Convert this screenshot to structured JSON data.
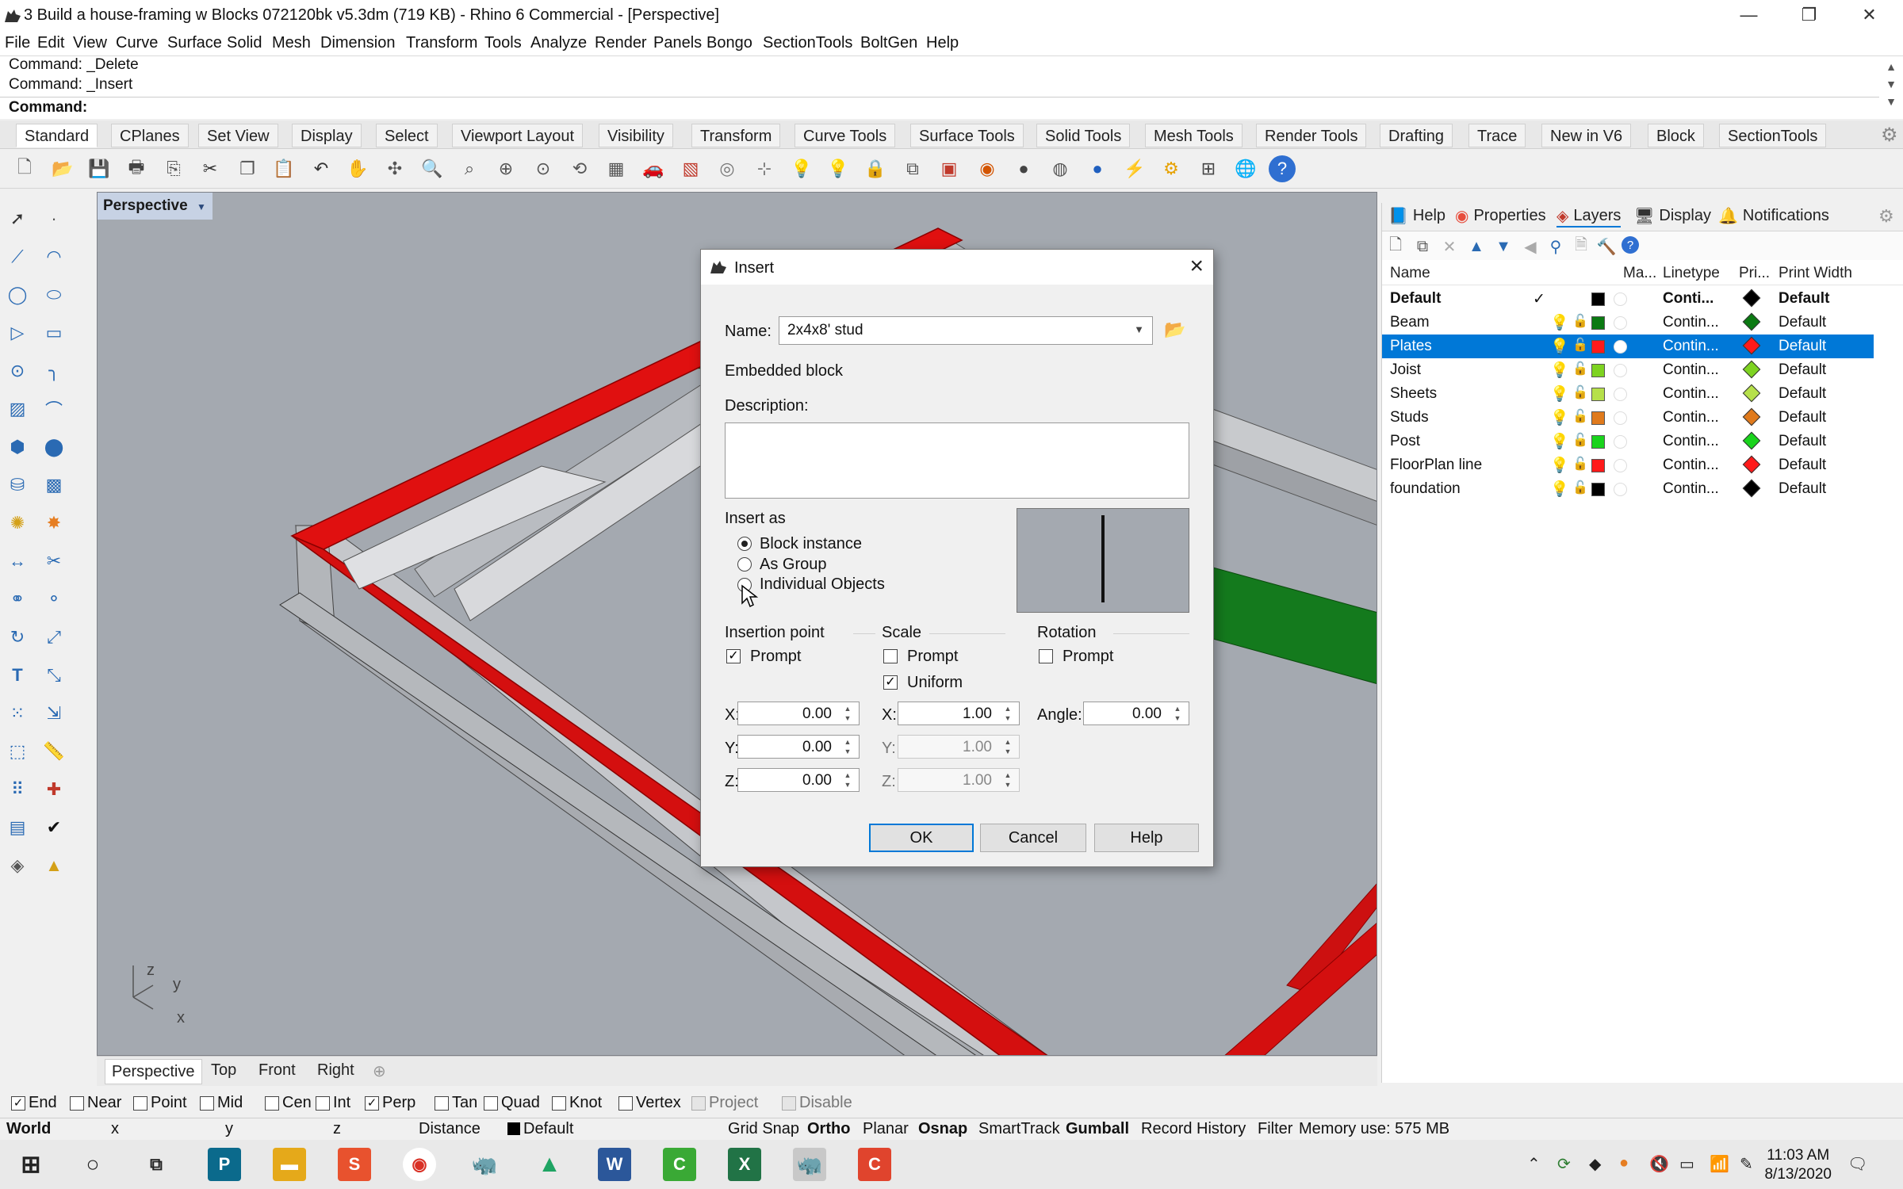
{
  "window": {
    "title": "3 Build a house-framing w Blocks 072120bk v5.3dm (719 KB) - Rhino 6 Commercial - [Perspective]",
    "minimize": "—",
    "restore": "❐",
    "close": "✕"
  },
  "menu": [
    "File",
    "Edit",
    "View",
    "Curve",
    "Surface",
    "Solid",
    "Mesh",
    "Dimension",
    "Transform",
    "Tools",
    "Analyze",
    "Render",
    "Panels",
    "Bongo",
    "SectionTools",
    "BoltGen",
    "Help"
  ],
  "command": {
    "history": [
      "Command: _Delete",
      "Command: _Insert"
    ],
    "prompt": "Command:"
  },
  "toolbar_tabs": [
    "Standard",
    "CPlanes",
    "Set View",
    "Display",
    "Select",
    "Viewport Layout",
    "Visibility",
    "Transform",
    "Curve Tools",
    "Surface Tools",
    "Solid Tools",
    "Mesh Tools",
    "Render Tools",
    "Drafting",
    "Trace",
    "New in V6",
    "Block",
    "SectionTools"
  ],
  "viewport": {
    "label": "Perspective",
    "axes": {
      "z": "z",
      "y": "y",
      "x": "x"
    },
    "tabs": [
      "Perspective",
      "Top",
      "Front",
      "Right"
    ],
    "add_tab": "⊕"
  },
  "panel": {
    "tabs": [
      {
        "label": "Help",
        "icon": "book-icon"
      },
      {
        "label": "Properties",
        "icon": "color-wheel-icon"
      },
      {
        "label": "Layers",
        "icon": "layers-icon"
      },
      {
        "label": "Display",
        "icon": "monitor-icon"
      },
      {
        "label": "Notifications",
        "icon": "bell-icon"
      }
    ],
    "columns": {
      "name": "Name",
      "material": "Ma...",
      "linetype": "Linetype",
      "print": "Pri...",
      "print_width": "Print Width"
    },
    "layers": [
      {
        "name": "Default",
        "current": "✓",
        "color": "#000000",
        "linetype": "Conti...",
        "print_color": "#000000",
        "print_width": "Default",
        "bold": true
      },
      {
        "name": "Beam",
        "color": "#0b7a12",
        "linetype": "Contin...",
        "print_color": "#0b7a12",
        "print_width": "Default"
      },
      {
        "name": "Plates",
        "color": "#ff1a1a",
        "linetype": "Contin...",
        "print_color": "#ff1a1a",
        "print_width": "Default",
        "selected": true
      },
      {
        "name": "Joist",
        "color": "#7ed321",
        "linetype": "Contin...",
        "print_color": "#7ed321",
        "print_width": "Default"
      },
      {
        "name": "Sheets",
        "color": "#b6e04a",
        "linetype": "Contin...",
        "print_color": "#b6e04a",
        "print_width": "Default"
      },
      {
        "name": "Studs",
        "color": "#e07a1c",
        "linetype": "Contin...",
        "print_color": "#e07a1c",
        "print_width": "Default"
      },
      {
        "name": "Post",
        "color": "#19d41c",
        "linetype": "Contin...",
        "print_color": "#19d41c",
        "print_width": "Default"
      },
      {
        "name": "FloorPlan line",
        "color": "#ff1a1a",
        "linetype": "Contin...",
        "print_color": "#ff1a1a",
        "print_width": "Default"
      },
      {
        "name": "foundation",
        "color": "#000000",
        "linetype": "Contin...",
        "print_color": "#000000",
        "print_width": "Default"
      }
    ]
  },
  "dialog": {
    "title": "Insert",
    "name_label": "Name:",
    "name_value": "2x4x8' stud",
    "block_type": "Embedded block",
    "description_label": "Description:",
    "description_value": "",
    "insert_as_label": "Insert as",
    "insert_as_options": [
      {
        "label": "Block instance",
        "checked": true
      },
      {
        "label": "As Group",
        "checked": false
      },
      {
        "label": "Individual Objects",
        "checked": false
      }
    ],
    "insertion_point": {
      "label": "Insertion point",
      "prompt_label": "Prompt",
      "prompt": true,
      "x_label": "X:",
      "y_label": "Y:",
      "z_label": "Z:",
      "x": "0.00",
      "y": "0.00",
      "z": "0.00"
    },
    "scale": {
      "label": "Scale",
      "prompt_label": "Prompt",
      "prompt": false,
      "uniform_label": "Uniform",
      "uniform": true,
      "x_label": "X:",
      "y_label": "Y:",
      "z_label": "Z:",
      "x": "1.00",
      "y": "1.00",
      "z": "1.00"
    },
    "rotation": {
      "label": "Rotation",
      "prompt_label": "Prompt",
      "prompt": false,
      "angle_label": "Angle:",
      "angle": "0.00"
    },
    "buttons": {
      "ok": "OK",
      "cancel": "Cancel",
      "help": "Help"
    }
  },
  "osnap": [
    {
      "label": "End",
      "checked": true
    },
    {
      "label": "Near",
      "checked": false
    },
    {
      "label": "Point",
      "checked": false
    },
    {
      "label": "Mid",
      "checked": false
    },
    {
      "label": "Cen",
      "checked": false
    },
    {
      "label": "Int",
      "checked": false
    },
    {
      "label": "Perp",
      "checked": true
    },
    {
      "label": "Tan",
      "checked": false
    },
    {
      "label": "Quad",
      "checked": false
    },
    {
      "label": "Knot",
      "checked": false
    },
    {
      "label": "Vertex",
      "checked": false
    },
    {
      "label": "Project",
      "checked": false,
      "disabled": true
    },
    {
      "label": "Disable",
      "checked": false,
      "disabled": true
    }
  ],
  "status": {
    "world": "World",
    "x": "x",
    "y": "y",
    "z": "z",
    "distance": "Distance",
    "layer": "Default",
    "grid_snap": "Grid Snap",
    "ortho": "Ortho",
    "planar": "Planar",
    "osnap": "Osnap",
    "smarttrack": "SmartTrack",
    "gumball": "Gumball",
    "record_history": "Record History",
    "filter": "Filter",
    "memory": "Memory use: 575 MB"
  },
  "taskbar": {
    "time": "11:03 AM",
    "date": "8/13/2020"
  }
}
